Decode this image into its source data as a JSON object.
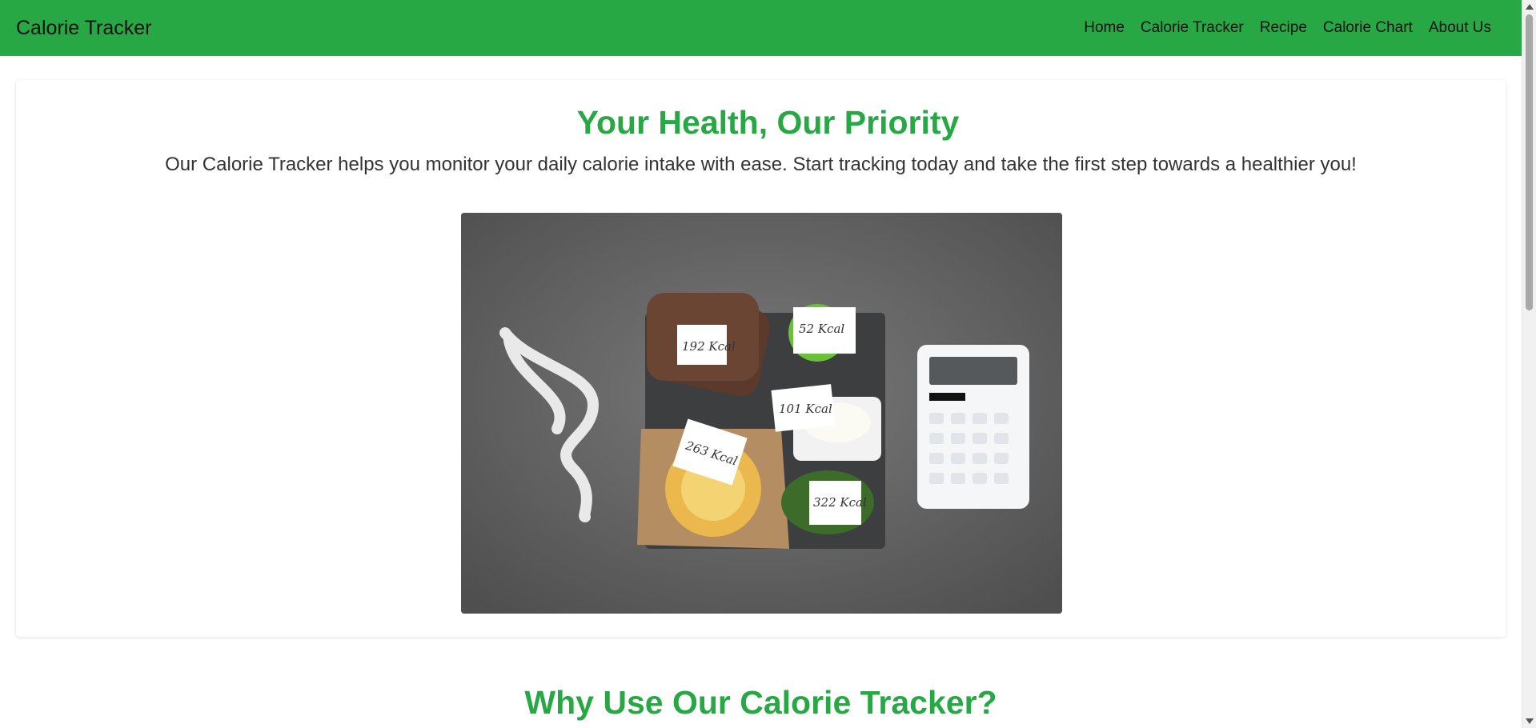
{
  "navbar": {
    "brand": "Calorie Tracker",
    "links": [
      "Home",
      "Calorie Tracker",
      "Recipe",
      "Calorie Chart",
      "About Us"
    ]
  },
  "hero": {
    "title": "Your Health, Our Priority",
    "text": "Our Calorie Tracker helps you monitor your daily calorie intake with ease. Start tracking today and take the first step towards a healthier you!",
    "image_labels": [
      "192 Kcal",
      "52 Kcal",
      "101 Kcal",
      "263 Kcal",
      "322 Kcal"
    ]
  },
  "section2": {
    "title": "Why Use Our Calorie Tracker?"
  },
  "colors": {
    "accent": "#28a745"
  }
}
